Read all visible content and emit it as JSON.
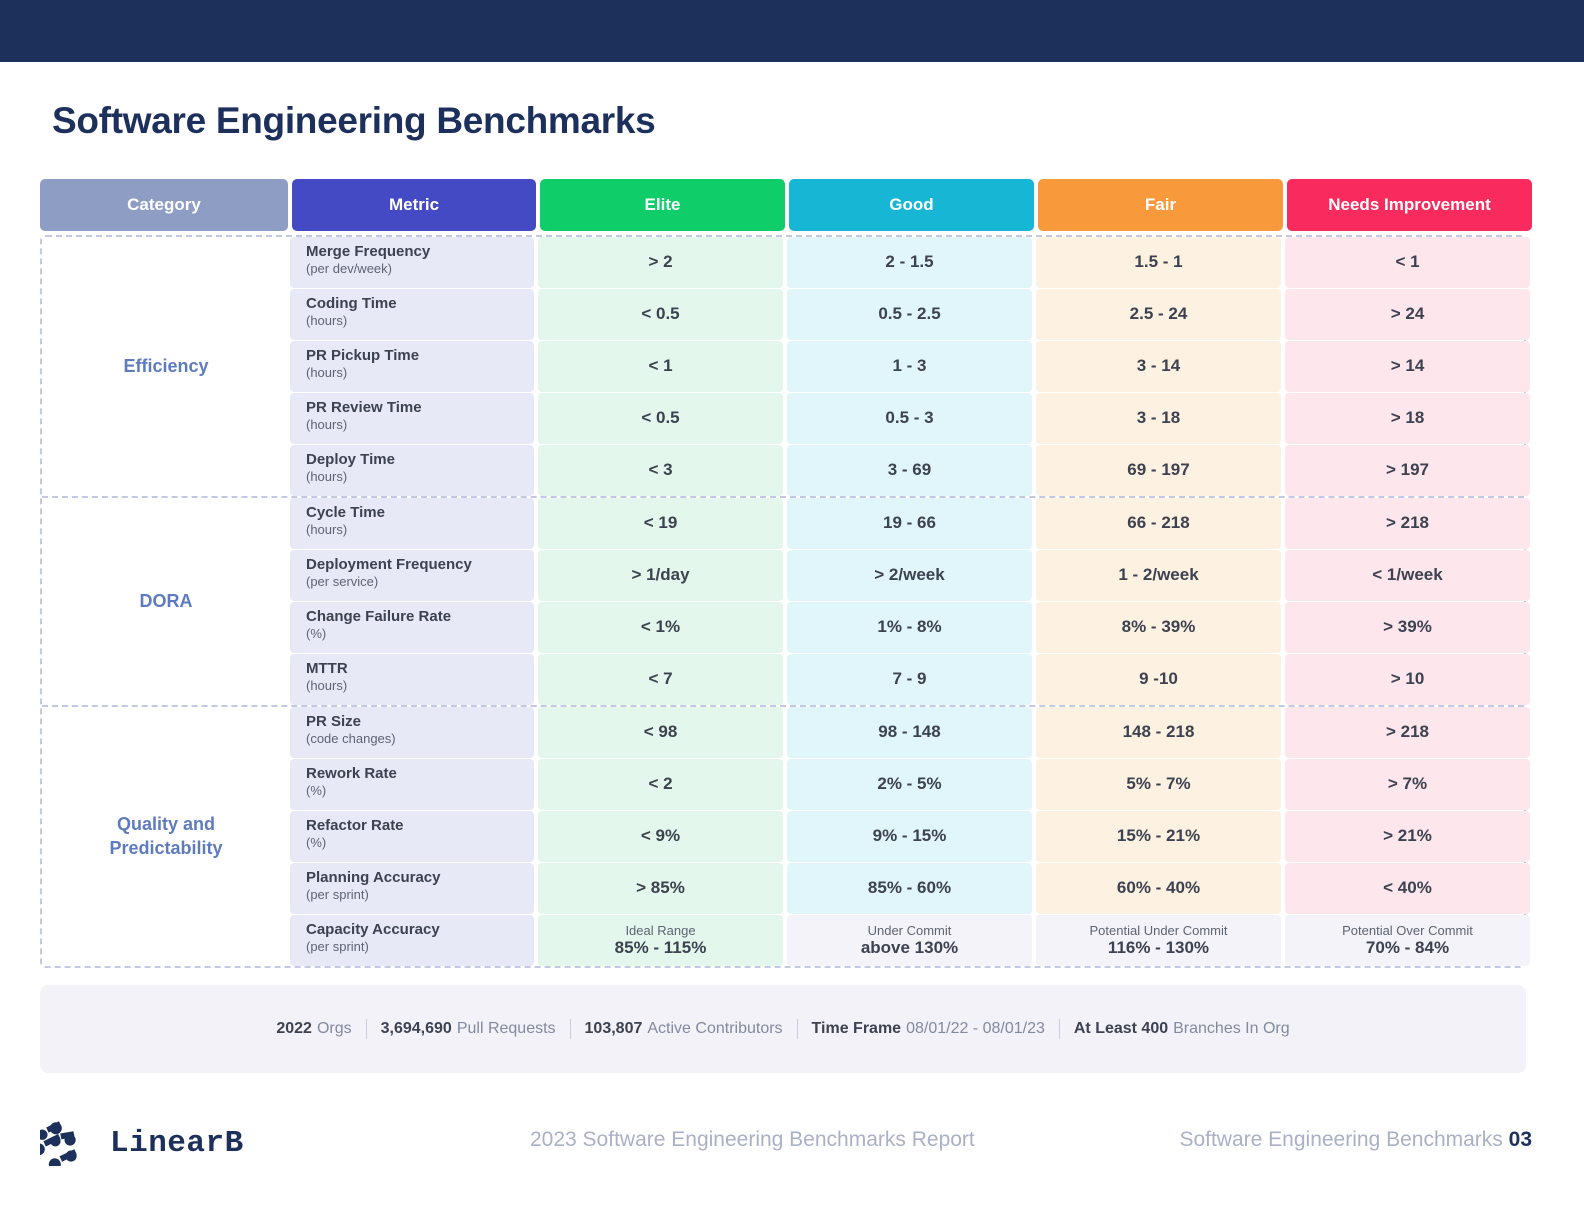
{
  "page_title": "Software Engineering Benchmarks",
  "colors": {
    "topbar": "#1d305c",
    "category_header": "#8e9dc4",
    "metric_header": "#4449c4",
    "elite_header": "#0fce6a",
    "good_header": "#16b6d4",
    "fair_header": "#f89a3c",
    "needs_header": "#f92b5e"
  },
  "table": {
    "headers": {
      "category": "Category",
      "metric": "Metric",
      "elite": "Elite",
      "good": "Good",
      "fair": "Fair",
      "needs": "Needs Improvement"
    },
    "groups": [
      {
        "category": "Efficiency",
        "rows": [
          {
            "metric": "Merge Frequency",
            "unit": "(per dev/week)",
            "elite": "> 2",
            "good": "2 - 1.5",
            "fair": "1.5 - 1",
            "needs": "< 1"
          },
          {
            "metric": "Coding Time",
            "unit": "(hours)",
            "elite": "< 0.5",
            "good": "0.5 - 2.5",
            "fair": "2.5 - 24",
            "needs": "> 24"
          },
          {
            "metric": "PR Pickup Time",
            "unit": "(hours)",
            "elite": "< 1",
            "good": "1 - 3",
            "fair": "3 - 14",
            "needs": "> 14"
          },
          {
            "metric": "PR Review Time",
            "unit": "(hours)",
            "elite": "< 0.5",
            "good": "0.5 - 3",
            "fair": "3 - 18",
            "needs": "> 18"
          },
          {
            "metric": "Deploy Time",
            "unit": "(hours)",
            "elite": "< 3",
            "good": "3 - 69",
            "fair": "69 - 197",
            "needs": "> 197"
          }
        ]
      },
      {
        "category": "DORA",
        "rows": [
          {
            "metric": "Cycle Time",
            "unit": "(hours)",
            "elite": "< 19",
            "good": "19 - 66",
            "fair": "66 - 218",
            "needs": "> 218"
          },
          {
            "metric": "Deployment Frequency",
            "unit": "(per service)",
            "elite": "> 1/day",
            "good": "> 2/week",
            "fair": "1 - 2/week",
            "needs": "< 1/week"
          },
          {
            "metric": "Change Failure Rate",
            "unit": "(%)",
            "elite": "< 1%",
            "good": "1% - 8%",
            "fair": "8% - 39%",
            "needs": "> 39%"
          },
          {
            "metric": "MTTR",
            "unit": "(hours)",
            "elite": "< 7",
            "good": "7 - 9",
            "fair": "9 -10",
            "needs": "> 10"
          }
        ]
      },
      {
        "category": "Quality and\nPredictability",
        "category_line1": "Quality and",
        "category_line2": "Predictability",
        "rows": [
          {
            "metric": "PR Size",
            "unit": "(code changes)",
            "elite": "< 98",
            "good": "98 - 148",
            "fair": "148 - 218",
            "needs": "> 218"
          },
          {
            "metric": "Rework Rate",
            "unit": "(%)",
            "elite": "< 2",
            "good": "2% - 5%",
            "fair": "5% - 7%",
            "needs": "> 7%"
          },
          {
            "metric": "Refactor Rate",
            "unit": "(%)",
            "elite": "< 9%",
            "good": "9% - 15%",
            "fair": "15% - 21%",
            "needs": "> 21%"
          },
          {
            "metric": "Planning Accuracy",
            "unit": "(per sprint)",
            "elite": "> 85%",
            "good": "85% - 60%",
            "fair": "60% - 40%",
            "needs": "< 40%"
          },
          {
            "metric": "Capacity Accuracy",
            "unit": "(per sprint)",
            "elite_label": "Ideal Range",
            "elite": "85% - 115%",
            "good_label": "Under Commit",
            "good": "above 130%",
            "fair_label": "Potential Under Commit",
            "fair": "116% - 130%",
            "needs_label": "Potential Over Commit",
            "needs": "70% - 84%"
          }
        ]
      }
    ]
  },
  "stats": [
    {
      "value": "2022",
      "label": "Orgs"
    },
    {
      "value": "3,694,690",
      "label": "Pull Requests"
    },
    {
      "value": "103,807",
      "label": "Active Contributors"
    },
    {
      "value": "Time Frame",
      "label": "08/01/22 - 08/01/23"
    },
    {
      "value": "At Least 400",
      "label": "Branches In Org"
    }
  ],
  "footer": {
    "brand": "LinearB",
    "report": "2023 Software Engineering Benchmarks Report",
    "section": "Software Engineering Benchmarks",
    "page_number": "03"
  }
}
